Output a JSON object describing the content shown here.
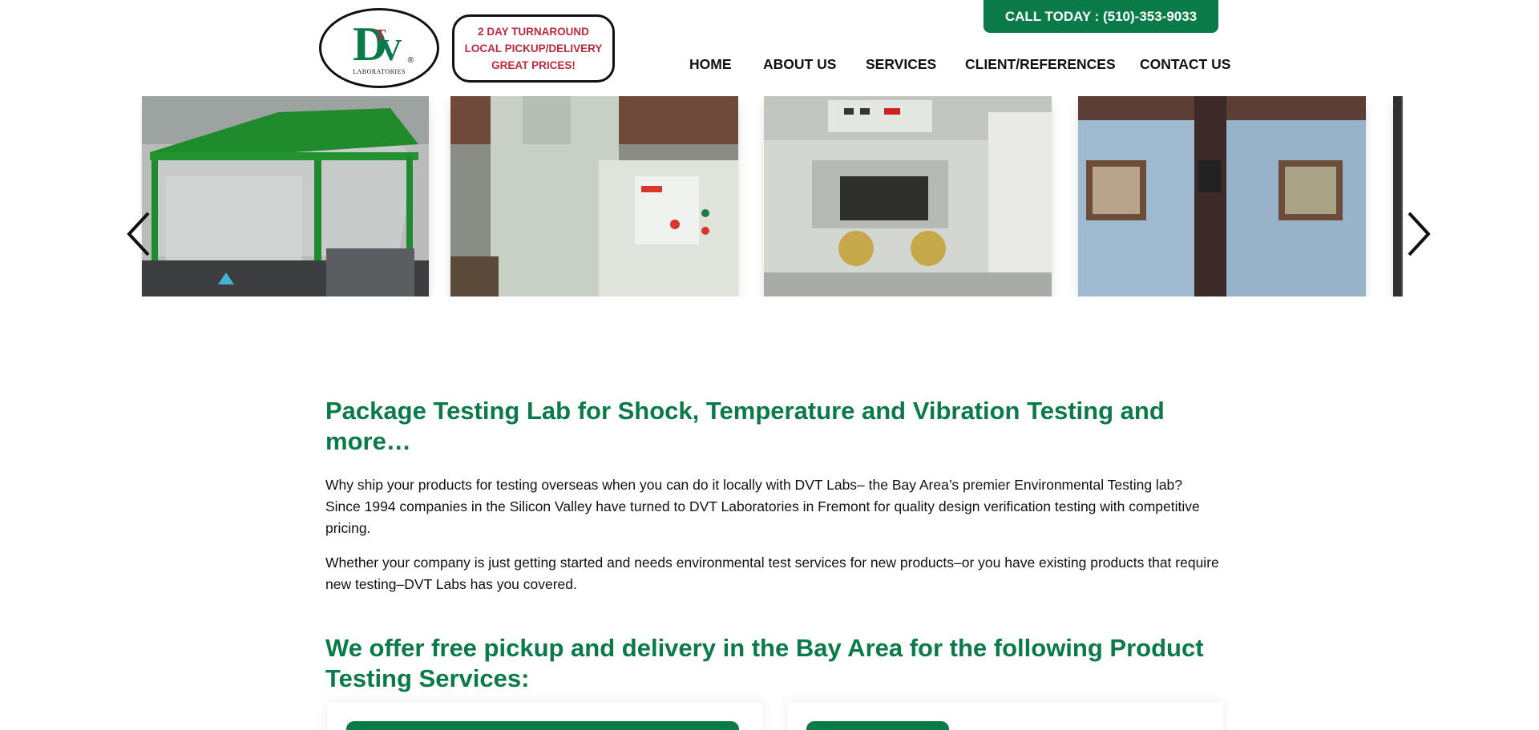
{
  "header": {
    "logo_text": "LABORATORIES",
    "logo_letters": {
      "d": "D",
      "t": "T",
      "v": "V",
      "reg": "®"
    },
    "promo_lines": [
      "2 DAY TURNAROUND",
      "LOCAL PICKUP/DELIVERY",
      "GREAT PRICES!"
    ],
    "call_label": "CALL TODAY : (510)-353-9033"
  },
  "nav": {
    "items": [
      {
        "label": "HOME"
      },
      {
        "label": "ABOUT US"
      },
      {
        "label": "SERVICES"
      },
      {
        "label": "CLIENT/REFERENCES"
      },
      {
        "label": "CONTACT US"
      }
    ]
  },
  "carousel": {
    "prev_icon": "chevron-left-icon",
    "next_icon": "chevron-right-icon"
  },
  "main": {
    "heading1": "Package Testing Lab for Shock, Temperature and Vibration Testing and more…",
    "para1": "Why ship your products for testing overseas when you can do it locally with DVT Labs– the Bay Area’s premier Environmental Testing lab? Since 1994 companies in the Silicon Valley have turned to DVT Laboratories in Fremont for quality design verification testing with competitive pricing.",
    "para2": "Whether your company is just getting started and needs environmental test services for new products–or you have existing products that require new testing–DVT Labs has you covered.",
    "heading2": "We offer free pickup and delivery in the Bay Area for the following Product Testing Services:"
  },
  "colors": {
    "brand_green": "#0a7a49",
    "promo_red": "#c0283f"
  }
}
